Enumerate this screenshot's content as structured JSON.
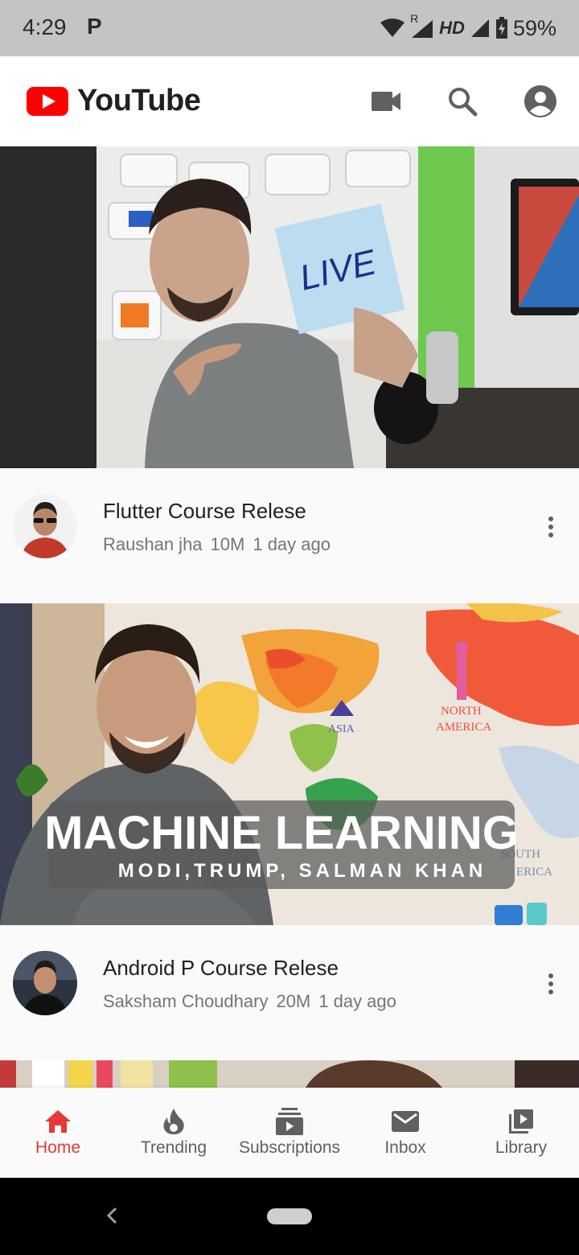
{
  "status_bar": {
    "time": "4:29",
    "notification_letter": "P",
    "network_label": "HD",
    "roaming": "R",
    "battery": "59%"
  },
  "app_bar": {
    "title": "YouTube",
    "brand_color": "#ff0000",
    "icons": [
      "video-camera-icon",
      "search-icon",
      "account-icon"
    ]
  },
  "videos": [
    {
      "title": "Flutter Course Relese",
      "channel": "Raushan jha",
      "views": "10M",
      "age": "1 day ago",
      "thumbnail_text": "LIVE"
    },
    {
      "title": "Android P Course Relese",
      "channel": "Saksham Choudhary",
      "views": "20M",
      "age": "1 day ago",
      "thumbnail_text": "MACHINE LEARNING",
      "thumbnail_subtext": "MODI,TRUMP, SALMAN KHAN",
      "map_label_asia": "ASIA",
      "map_label_na_1": "NORTH",
      "map_label_na_2": "AMERICA",
      "map_label_sa_1": "SOUTH",
      "map_label_sa_2": "ERICA"
    }
  ],
  "bottom_nav": {
    "active_color": "#e53935",
    "items": [
      {
        "label": "Home",
        "icon": "home-icon",
        "active": true
      },
      {
        "label": "Trending",
        "icon": "flame-icon",
        "active": false
      },
      {
        "label": "Subscriptions",
        "icon": "subscriptions-icon",
        "active": false
      },
      {
        "label": "Inbox",
        "icon": "mail-icon",
        "active": false
      },
      {
        "label": "Library",
        "icon": "library-icon",
        "active": false
      }
    ]
  }
}
